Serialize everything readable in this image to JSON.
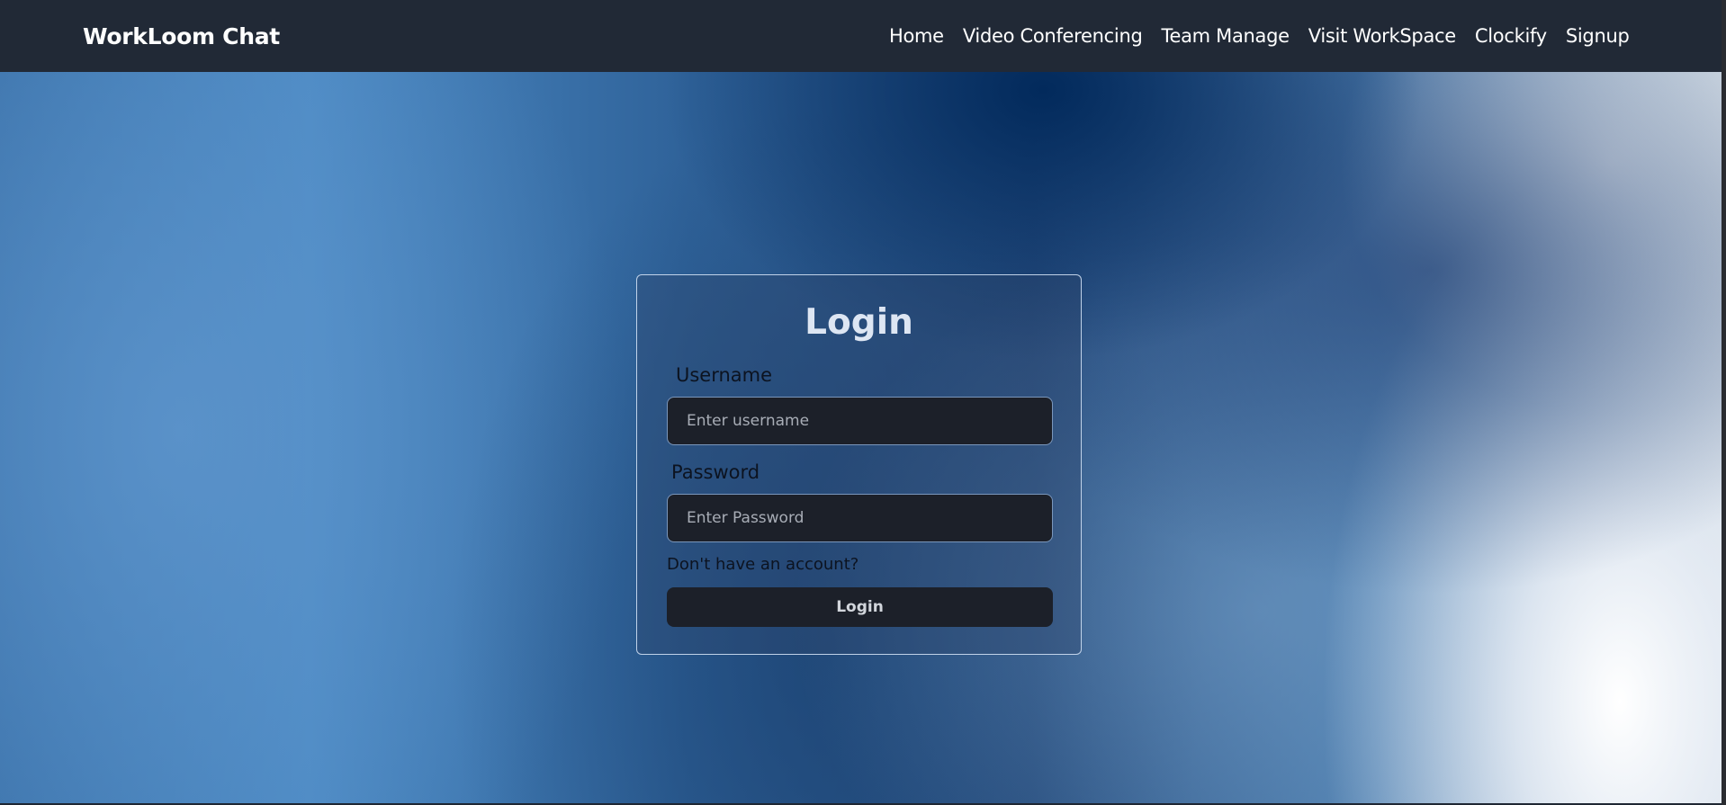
{
  "navbar": {
    "brand": "WorkLoom Chat",
    "links": [
      {
        "label": "Home"
      },
      {
        "label": "Video Conferencing"
      },
      {
        "label": "Team Manage"
      },
      {
        "label": "Visit WorkSpace"
      },
      {
        "label": "Clockify"
      },
      {
        "label": "Signup"
      }
    ]
  },
  "login": {
    "title": "Login",
    "username_label": "Username",
    "username_placeholder": "Enter username",
    "password_label": "Password",
    "password_placeholder": "Enter Password",
    "signup_prompt": "Don't have an account?",
    "submit_label": "Login"
  },
  "colors": {
    "navbar_bg": "#212936",
    "input_bg": "#1c2029",
    "card_border": "#d2e1f5"
  }
}
